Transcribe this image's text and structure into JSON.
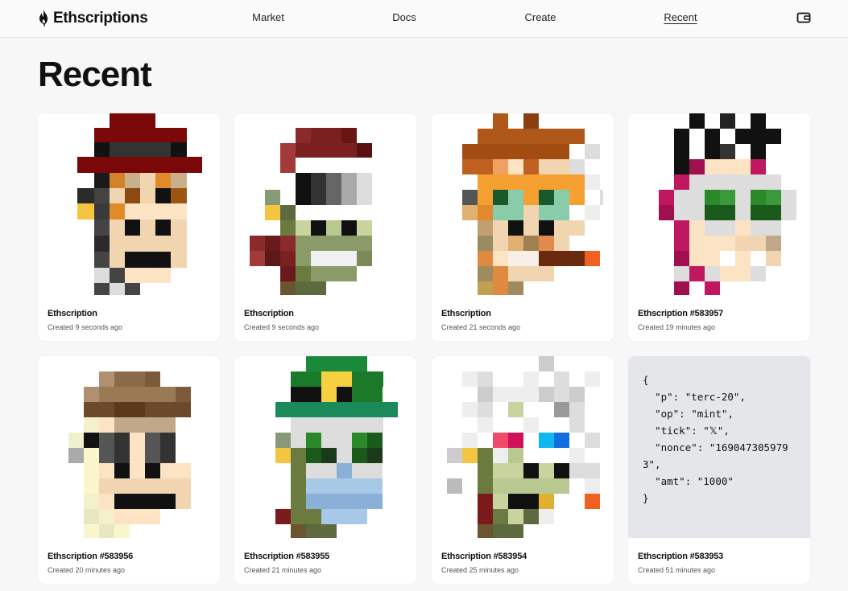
{
  "brand": {
    "name": "Ethscriptions"
  },
  "nav": [
    {
      "label": "Market",
      "active": false
    },
    {
      "label": "Docs",
      "active": false
    },
    {
      "label": "Create",
      "active": false
    },
    {
      "label": "Recent",
      "active": true
    }
  ],
  "page": {
    "title": "Recent"
  },
  "cards": [
    {
      "name": "Ethscription",
      "time": "Created 9 seconds ago"
    },
    {
      "name": "Ethscription",
      "time": "Created 9 seconds ago"
    },
    {
      "name": "Ethscription",
      "time": "Created 21 seconds ago"
    },
    {
      "name": "Ethscription #583957",
      "time": "Created 19 minutes ago"
    },
    {
      "name": "Ethscription #583956",
      "time": "Created 20 minutes ago"
    },
    {
      "name": "Ethscription #583955",
      "time": "Created 21 minutes ago"
    },
    {
      "name": "Ethscription #583954",
      "time": "Created 25 minutes ago"
    },
    {
      "name": "Ethscription #583953",
      "time": "Created 51 minutes ago",
      "content": "{\n  \"p\": \"terc-20\",\n  \"op\": \"mint\",\n  \"tick\": \"𝕏\",\n  \"nonce\": \"1690473059793\",\n  \"amt\": \"1000\"\n}"
    }
  ],
  "icons": {
    "logo": "flame-icon",
    "wallet": "wallet-icon"
  },
  "colors": {
    "background": "#f7f7f7",
    "card": "#ffffff",
    "text_card": "#e5e6e9"
  }
}
